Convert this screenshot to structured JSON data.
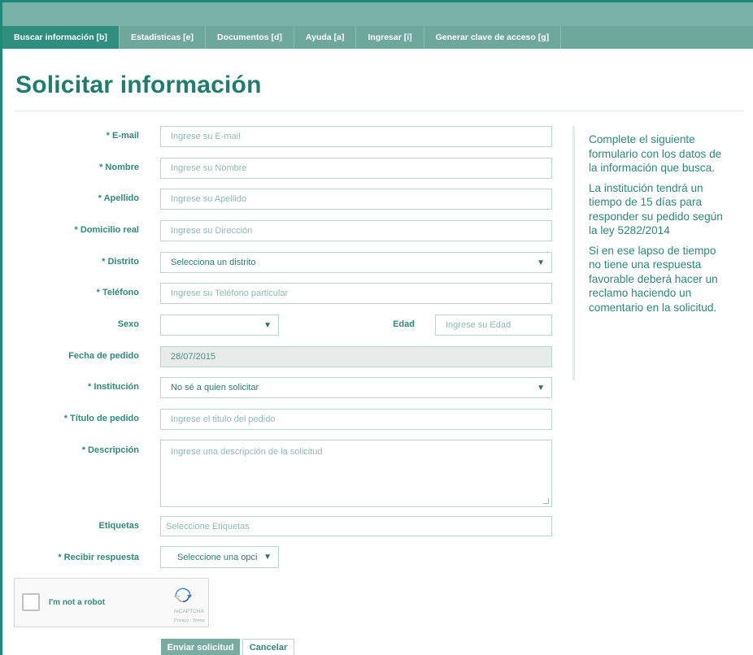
{
  "nav": {
    "tabs": [
      {
        "label": "Buscar información [b]"
      },
      {
        "label": "Estadísticas [e]"
      },
      {
        "label": "Documentos [d]"
      },
      {
        "label": "Ayuda [a]"
      },
      {
        "label": "Ingresar [i]"
      },
      {
        "label": "Generar clave de acceso [g]"
      }
    ]
  },
  "page": {
    "title": "Solicitar información"
  },
  "form": {
    "email": {
      "label": "* E-mail",
      "placeholder": "Ingrese su E-mail"
    },
    "nombre": {
      "label": "* Nombre",
      "placeholder": "Ingrese su Nombre"
    },
    "apellido": {
      "label": "* Apellido",
      "placeholder": "Ingrese su Apellido"
    },
    "domicilio": {
      "label": "* Domicilio real",
      "placeholder": "Ingrese su Dirección"
    },
    "distrito": {
      "label": "* Distrito",
      "value": "Selecciona un distrito"
    },
    "telefono": {
      "label": "* Teléfono",
      "placeholder": "Ingrese su Teléfono particular"
    },
    "sexo": {
      "label": "Sexo",
      "value": ""
    },
    "edad": {
      "label": "Edad",
      "placeholder": "Ingrese su Edad"
    },
    "fecha": {
      "label": "Fecha de pedido",
      "value": "28/07/2015"
    },
    "institucion": {
      "label": "* Institución",
      "value": "No sé a quien solicitar"
    },
    "titulo": {
      "label": "* Título de pedido",
      "placeholder": "Ingrese el titulo del pedido"
    },
    "descripcion": {
      "label": "* Descripción",
      "placeholder": "Ingrese una descripción de la solicitud"
    },
    "etiquetas": {
      "label": "Etiquetas",
      "placeholder": "Seleccione Etiquetas"
    },
    "respuesta": {
      "label": "* Recibir respuesta",
      "value": "Seleccione una opci"
    }
  },
  "sidebar": {
    "paragraphs": [
      "Complete el siguiente formulario con los datos de la información que busca.",
      "La institución tendrá un tiempo de 15 días para responder su pedido según la ley 5282/2014",
      "Si en ese lapso de tiempo no tiene una respuesta favorable deberá hacer un reclamo haciendo un comentario en la solicitud."
    ]
  },
  "captcha": {
    "label": "I'm not a robot",
    "brand": "reCAPTCHA",
    "terms": "Privacy - Terms"
  },
  "buttons": {
    "submit": "Enviar solicitud",
    "cancel": "Cancelar"
  },
  "colors": {
    "accent": "#1e7d6d",
    "nav": "#6ea79b",
    "nav_active": "#2e8f7f"
  }
}
